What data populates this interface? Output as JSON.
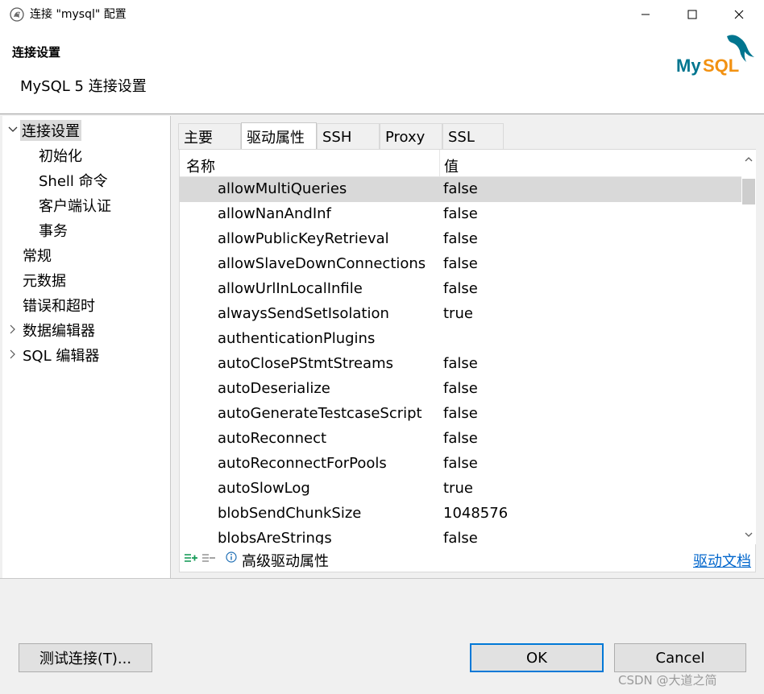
{
  "window": {
    "title": "连接 \"mysql\" 配置"
  },
  "header": {
    "title": "连接设置",
    "subtitle": "MySQL 5 连接设置",
    "logo_text": "MySQL"
  },
  "nav": {
    "items": [
      {
        "label": "连接设置",
        "expanded": true,
        "selected": true
      },
      {
        "label": "初始化"
      },
      {
        "label": "Shell 命令"
      },
      {
        "label": "客户端认证"
      },
      {
        "label": "事务"
      },
      {
        "label": "常规"
      },
      {
        "label": "元数据"
      },
      {
        "label": "错误和超时"
      },
      {
        "label": "数据编辑器",
        "expandable": true
      },
      {
        "label": "SQL 编辑器",
        "expandable": true
      }
    ]
  },
  "tabs": [
    {
      "label": "主要"
    },
    {
      "label": "驱动属性",
      "active": true
    },
    {
      "label": "SSH"
    },
    {
      "label": "Proxy"
    },
    {
      "label": "SSL"
    }
  ],
  "table": {
    "columns": [
      "名称",
      "值"
    ],
    "rows": [
      {
        "name": "allowMultiQueries",
        "value": "false"
      },
      {
        "name": "allowNanAndInf",
        "value": "false"
      },
      {
        "name": "allowPublicKeyRetrieval",
        "value": "false"
      },
      {
        "name": "allowSlaveDownConnections",
        "value": "false"
      },
      {
        "name": "allowUrlInLocalInfile",
        "value": "false"
      },
      {
        "name": "alwaysSendSetIsolation",
        "value": "true"
      },
      {
        "name": "authenticationPlugins",
        "value": ""
      },
      {
        "name": "autoClosePStmtStreams",
        "value": "false"
      },
      {
        "name": "autoDeserialize",
        "value": "false"
      },
      {
        "name": "autoGenerateTestcaseScript",
        "value": "false"
      },
      {
        "name": "autoReconnect",
        "value": "false"
      },
      {
        "name": "autoReconnectForPools",
        "value": "false"
      },
      {
        "name": "autoSlowLog",
        "value": "true"
      },
      {
        "name": "blobSendChunkSize",
        "value": "1048576"
      },
      {
        "name": "blobsAreStrings",
        "value": "false"
      }
    ]
  },
  "panel_footer": {
    "advanced_label": "高级驱动属性",
    "doc_link": "驱动文档"
  },
  "buttons": {
    "test": "测试连接(T)...",
    "ok": "OK",
    "cancel": "Cancel"
  },
  "watermark": "CSDN @大道之简",
  "colors": {
    "accent": "#0078d7",
    "link": "#0066cc",
    "logo_teal": "#00758f",
    "logo_orange": "#f29111",
    "add_icon": "#1a9c5a"
  },
  "icons": [
    "app-icon",
    "minimize-icon",
    "maximize-icon",
    "close-icon",
    "chevron-down-icon",
    "chevron-right-icon",
    "scroll-up-icon",
    "scroll-down-icon",
    "add-property-icon",
    "remove-property-icon",
    "info-icon"
  ]
}
